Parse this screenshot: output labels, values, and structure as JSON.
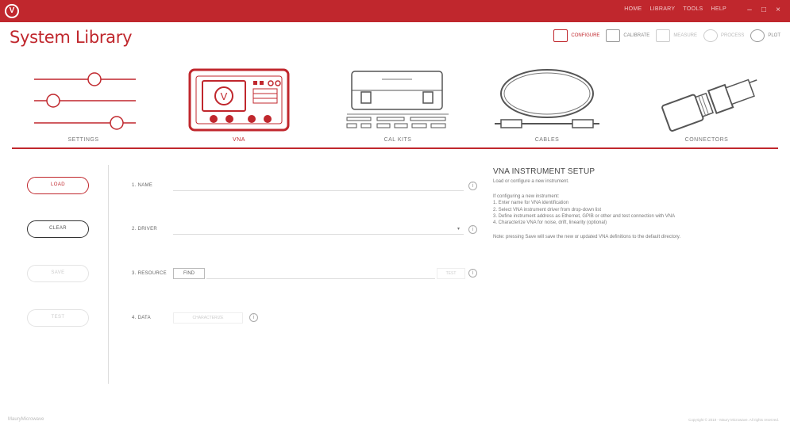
{
  "titlebar": {
    "menu": [
      "HOME",
      "LIBRARY",
      "TOOLS",
      "HELP"
    ]
  },
  "app": {
    "title": "System Library"
  },
  "toolbar": {
    "items": [
      {
        "label": "CONFIGURE",
        "icon": "configure-icon",
        "state": "active"
      },
      {
        "label": "CALIBRATE",
        "icon": "calibrate-icon",
        "state": "normal"
      },
      {
        "label": "MEASURE",
        "icon": "measure-icon",
        "state": "disabled"
      },
      {
        "label": "PROCESS",
        "icon": "process-icon",
        "state": "disabled"
      },
      {
        "label": "PLOT",
        "icon": "plot-icon",
        "state": "normal"
      }
    ]
  },
  "categories": [
    {
      "label": "SETTINGS",
      "icon": "sliders-icon",
      "active": false
    },
    {
      "label": "VNA",
      "icon": "vna-instrument-icon",
      "active": true
    },
    {
      "label": "CAL KITS",
      "icon": "cal-kit-case-icon",
      "active": false
    },
    {
      "label": "CABLES",
      "icon": "cable-icon",
      "active": false
    },
    {
      "label": "CONNECTORS",
      "icon": "connector-icon",
      "active": false
    }
  ],
  "buttons": {
    "load": "LOAD",
    "clear": "CLEAR",
    "save": "SAVE",
    "test": "TEST"
  },
  "form": {
    "name_label": "1. NAME",
    "driver_label": "2. DRIVER",
    "resource_label": "3. RESOURCE",
    "resource_find": "FIND",
    "resource_test": "TEST",
    "data_label": "4. DATA",
    "data_button": "CHARACTERIZE"
  },
  "instructions": {
    "title": "VNA INSTRUMENT SETUP",
    "subtitle": "Load or configure a new instrument.",
    "steps_heading": "If configuring a new instrument:",
    "steps": [
      "1.  Enter name for VNA identification",
      "2.  Select VNA instrument driver from drop-down list",
      "3.  Define instrument address as Ethernet, GPIB or other and test connection with VNA",
      "4.  Characterize VNA for noise, drift, linearity (optional)"
    ],
    "note": "Note: pressing Save will save the new or updated VNA definitions to the default directory."
  },
  "footer": {
    "left": "MauryMicrowave",
    "right": "Copyright © 2019 - Maury Microwave. All rights reserved."
  },
  "colors": {
    "accent": "#c0272d",
    "text": "#555555",
    "divider": "#dddddd"
  }
}
